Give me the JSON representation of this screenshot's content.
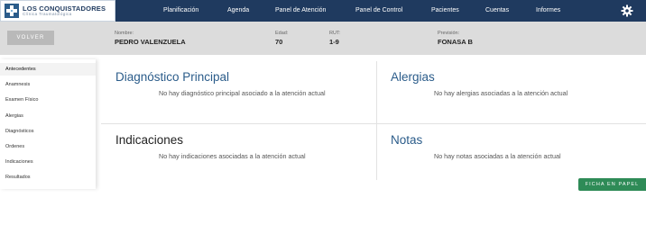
{
  "logo": {
    "title": "Los Conquistadores",
    "subtitle": "Clínica Traumatológica"
  },
  "nav": {
    "items": [
      "Planificación",
      "Agenda",
      "Panel de Atención",
      "Panel de Control",
      "Pacientes",
      "Cuentas",
      "Informes"
    ],
    "settings_icon": "gear-icon"
  },
  "patient": {
    "back_label": "VOLVER",
    "name_label": "Nombre:",
    "name": "PEDRO VALENZUELA",
    "age_label": "Edad:",
    "age": "70",
    "rut_label": "RUT:",
    "rut": "1-9",
    "prevision_label": "Previsión:",
    "prevision": "FONASA B"
  },
  "sidebar": {
    "items": [
      "Antecedentes",
      "Anamnesis",
      "Examen Físico",
      "Alergias",
      "Diagnósticos",
      "Ordenes",
      "Indicaciones",
      "Resultados"
    ],
    "active_index": 0
  },
  "cards": {
    "diagnostico": {
      "title": "Diagnóstico Principal",
      "message": "No hay diagnóstico principal asociado a la atención actual"
    },
    "alergias": {
      "title": "Alergias",
      "message": "No hay alergias asociadas a la atención actual"
    },
    "indicaciones": {
      "title": "Indicaciones",
      "message": "No hay indicaciones asociadas a la atención actual"
    },
    "notas": {
      "title": "Notas",
      "message": "No hay notas asociadas a la atención actual"
    }
  },
  "ficha_button": "FICHA EN PAPEL",
  "colors": {
    "nav_bg": "#1f3a5f",
    "title_blue": "#2b5c8a",
    "button_green": "#2e8b57",
    "patient_bg": "#dcdcdc"
  }
}
